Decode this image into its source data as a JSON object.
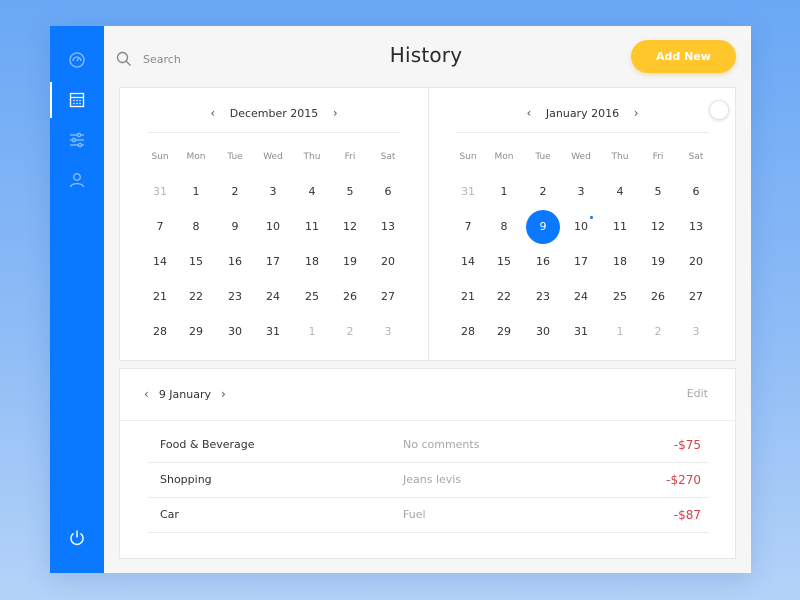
{
  "header": {
    "title": "History",
    "search_placeholder": "Search",
    "add_button_label": "Add New"
  },
  "sidebar": {
    "items": [
      {
        "icon": "gauge-icon",
        "active": false
      },
      {
        "icon": "calculator-icon",
        "active": true
      },
      {
        "icon": "sliders-icon",
        "active": false
      },
      {
        "icon": "user-icon",
        "active": false
      }
    ],
    "bottom_icon": "power-icon"
  },
  "calendar": {
    "weekdays": [
      "Sun",
      "Mon",
      "Tue",
      "Wed",
      "Thu",
      "Fri",
      "Sat"
    ],
    "left": {
      "month_label": "December 2015",
      "weeks": [
        [
          {
            "d": "31",
            "m": true
          },
          {
            "d": "1"
          },
          {
            "d": "2"
          },
          {
            "d": "3"
          },
          {
            "d": "4"
          },
          {
            "d": "5"
          },
          {
            "d": "6"
          }
        ],
        [
          {
            "d": "7"
          },
          {
            "d": "8"
          },
          {
            "d": "9"
          },
          {
            "d": "10"
          },
          {
            "d": "11"
          },
          {
            "d": "12"
          },
          {
            "d": "13"
          }
        ],
        [
          {
            "d": "14"
          },
          {
            "d": "15"
          },
          {
            "d": "16"
          },
          {
            "d": "17"
          },
          {
            "d": "18"
          },
          {
            "d": "19"
          },
          {
            "d": "20"
          }
        ],
        [
          {
            "d": "21"
          },
          {
            "d": "22"
          },
          {
            "d": "23"
          },
          {
            "d": "24"
          },
          {
            "d": "25"
          },
          {
            "d": "26"
          },
          {
            "d": "27"
          }
        ],
        [
          {
            "d": "28"
          },
          {
            "d": "29"
          },
          {
            "d": "30"
          },
          {
            "d": "31"
          },
          {
            "d": "1",
            "m": true
          },
          {
            "d": "2",
            "m": true
          },
          {
            "d": "3",
            "m": true
          }
        ]
      ]
    },
    "right": {
      "month_label": "January 2016",
      "weeks": [
        [
          {
            "d": "31",
            "m": true
          },
          {
            "d": "1"
          },
          {
            "d": "2"
          },
          {
            "d": "3"
          },
          {
            "d": "4"
          },
          {
            "d": "5"
          },
          {
            "d": "6"
          }
        ],
        [
          {
            "d": "7"
          },
          {
            "d": "8"
          },
          {
            "d": "9",
            "selected": true
          },
          {
            "d": "10",
            "dot": true
          },
          {
            "d": "11"
          },
          {
            "d": "12"
          },
          {
            "d": "13"
          }
        ],
        [
          {
            "d": "14"
          },
          {
            "d": "15"
          },
          {
            "d": "16"
          },
          {
            "d": "17"
          },
          {
            "d": "18"
          },
          {
            "d": "19"
          },
          {
            "d": "20"
          }
        ],
        [
          {
            "d": "21"
          },
          {
            "d": "22"
          },
          {
            "d": "23"
          },
          {
            "d": "24"
          },
          {
            "d": "25"
          },
          {
            "d": "26"
          },
          {
            "d": "27"
          }
        ],
        [
          {
            "d": "28"
          },
          {
            "d": "29"
          },
          {
            "d": "30"
          },
          {
            "d": "31"
          },
          {
            "d": "1",
            "m": true
          },
          {
            "d": "2",
            "m": true
          },
          {
            "d": "3",
            "m": true
          }
        ]
      ]
    }
  },
  "details": {
    "date_label": "9 January",
    "edit_label": "Edit",
    "transactions": [
      {
        "category": "Food & Beverage",
        "note": "No comments",
        "amount": "-$75"
      },
      {
        "category": "Shopping",
        "note": "Jeans levis",
        "amount": "-$270"
      },
      {
        "category": "Car",
        "note": "Fuel",
        "amount": "-$87"
      }
    ]
  },
  "colors": {
    "accent": "#0a79ff",
    "button": "#ffc72c",
    "negative": "#d9414a"
  }
}
